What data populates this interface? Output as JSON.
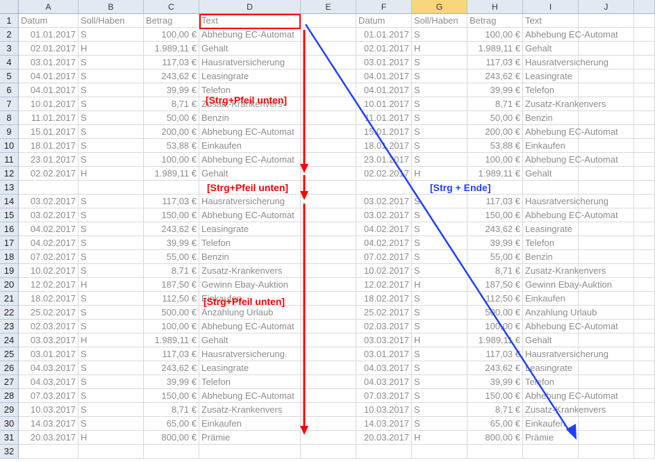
{
  "columns": [
    "A",
    "B",
    "C",
    "D",
    "E",
    "F",
    "G",
    "H",
    "I",
    "J"
  ],
  "selected_column": "G",
  "header_row": [
    "Datum",
    "Soll/Haben",
    "Betrag",
    "Text",
    "",
    "Datum",
    "Soll/Haben",
    "Betrag",
    "Text",
    ""
  ],
  "rows": [
    [
      "01.01.2017",
      "S",
      "100,00 €",
      "Abhebung EC-Automat"
    ],
    [
      "02.01.2017",
      "H",
      "1.989,11 €",
      "Gehalt"
    ],
    [
      "03.01.2017",
      "S",
      "117,03 €",
      "Hausratversicherung"
    ],
    [
      "04.01.2017",
      "S",
      "243,62 €",
      "Leasingrate"
    ],
    [
      "04.01.2017",
      "S",
      "39,99 €",
      "Telefon"
    ],
    [
      "10.01.2017",
      "S",
      "8,71 €",
      "Zusatz-Krankenvers"
    ],
    [
      "11.01.2017",
      "S",
      "50,00 €",
      "Benzin"
    ],
    [
      "15.01.2017",
      "S",
      "200,00 €",
      "Abhebung EC-Automat"
    ],
    [
      "18.01.2017",
      "S",
      "53,88 €",
      "Einkaufen"
    ],
    [
      "23.01.2017",
      "S",
      "100,00 €",
      "Abhebung EC-Automat"
    ],
    [
      "02.02.2017",
      "H",
      "1.989,11 €",
      "Gehalt"
    ],
    [
      "",
      "",
      "",
      ""
    ],
    [
      "03.02.2017",
      "S",
      "117,03 €",
      "Hausratversicherung"
    ],
    [
      "03.02.2017",
      "S",
      "150,00 €",
      "Abhebung EC-Automat"
    ],
    [
      "04.02.2017",
      "S",
      "243,62 €",
      "Leasingrate"
    ],
    [
      "04.02.2017",
      "S",
      "39,99 €",
      "Telefon"
    ],
    [
      "07.02.2017",
      "S",
      "55,00 €",
      "Benzin"
    ],
    [
      "10.02.2017",
      "S",
      "8,71 €",
      "Zusatz-Krankenvers"
    ],
    [
      "12.02.2017",
      "H",
      "187,50 €",
      "Gewinn Ebay-Auktion"
    ],
    [
      "18.02.2017",
      "S",
      "112,50 €",
      "Einkaufen"
    ],
    [
      "25.02.2017",
      "S",
      "500,00 €",
      "Anzahlung Urlaub"
    ],
    [
      "02.03.2017",
      "S",
      "100,00 €",
      "Abhebung EC-Automat"
    ],
    [
      "03.03.2017",
      "H",
      "1.989,11 €",
      "Gehalt"
    ],
    [
      "03.01.2017",
      "S",
      "117,03 €",
      "Hausratversicherung"
    ],
    [
      "04.03.2017",
      "S",
      "243,62 €",
      "Leasingrate"
    ],
    [
      "04.03.2017",
      "S",
      "39,99 €",
      "Telefon"
    ],
    [
      "07.03.2017",
      "S",
      "150,00 €",
      "Abhebung EC-Automat"
    ],
    [
      "10.03.2017",
      "S",
      "8,71 €",
      "Zusatz-Krankenvers"
    ],
    [
      "14.03.2017",
      "S",
      "65,00 €",
      "Einkaufen"
    ],
    [
      "20.03.2017",
      "H",
      "800,00 €",
      "Prämie"
    ],
    [
      "",
      "",
      "",
      ""
    ]
  ],
  "annotations": [
    {
      "id": "annot-strg-pfeil-1",
      "text": "[Strg+Pfeil unten]",
      "color": "red"
    },
    {
      "id": "annot-strg-pfeil-2",
      "text": "[Strg+Pfeil unten]",
      "color": "red"
    },
    {
      "id": "annot-strg-pfeil-3",
      "text": "[Strg+Pfeil unten]",
      "color": "red"
    },
    {
      "id": "annot-strg-ende",
      "text": "[Strg + Ende]",
      "color": "blue"
    }
  ],
  "colors": {
    "red": "#ff0000",
    "blue": "#1f3fff"
  }
}
